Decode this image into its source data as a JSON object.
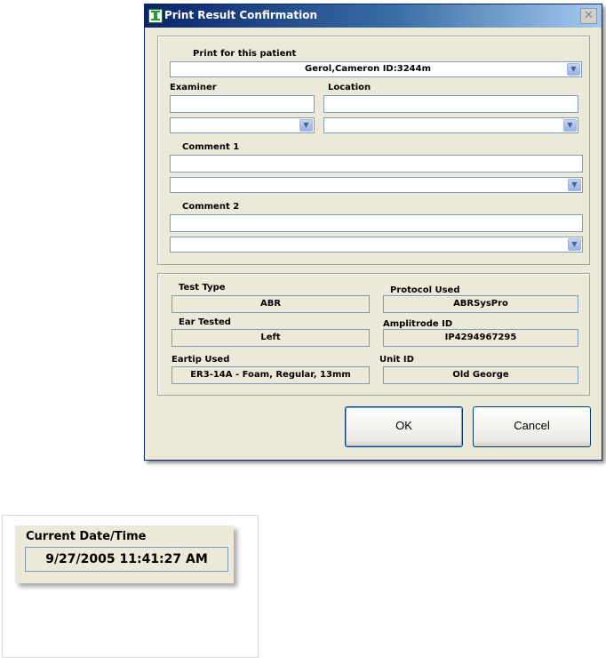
{
  "dialog": {
    "title": "Print Result Confirmation",
    "close_glyph": "✕",
    "patient_label": "Print for this patient",
    "patient_value": "Gerol,Cameron ID:3244m",
    "examiner_label": "Examiner",
    "examiner_value": "",
    "examiner_select": "",
    "location_label": "Location",
    "location_value": "",
    "location_select": "",
    "comment1_label": "Comment 1",
    "comment1_value": "",
    "comment1_select": "",
    "comment2_label": "Comment 2",
    "comment2_value": "",
    "comment2_select": "",
    "dropdown_glyph": "▼",
    "info": {
      "test_type_label": "Test Type",
      "test_type_value": "ABR",
      "protocol_label": "Protocol Used",
      "protocol_value": "ABRSysPro",
      "ear_label": "Ear Tested",
      "ear_value": "Left",
      "amplitrode_label": "Amplitrode ID",
      "amplitrode_value": "IP4294967295",
      "eartip_label": "Eartip Used",
      "eartip_value": "ER3-14A - Foam, Regular, 13mm",
      "unit_label": "Unit ID",
      "unit_value": "Old George"
    },
    "ok_label": "OK",
    "cancel_label": "Cancel"
  },
  "datetime": {
    "label": "Current Date/Time",
    "value": "9/27/2005 11:41:27 AM"
  },
  "colors": {
    "titlebar_start": "#0a246a",
    "titlebar_end": "#a6caf0",
    "dialog_bg": "#ece9d8",
    "field_border": "#7f9db9"
  }
}
